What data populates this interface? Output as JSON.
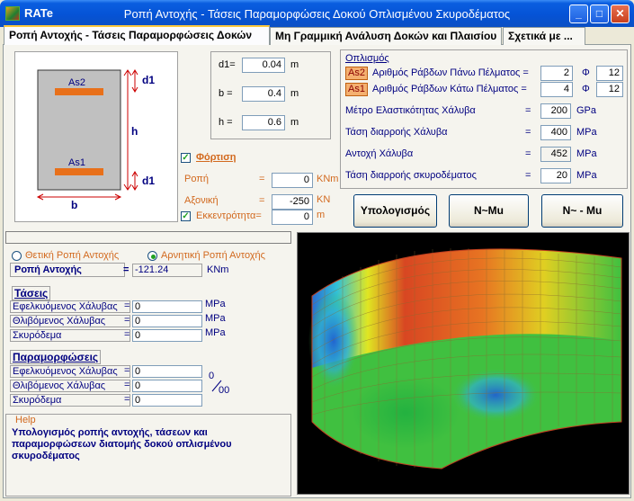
{
  "window": {
    "app_name": "RATe",
    "title": "Ροπή Αντοχής - Τάσεις Παραμορφώσεις Δοκού Οπλισμένου Σκυροδέματος",
    "min_label": "_",
    "max_label": "□",
    "close_label": "✕"
  },
  "tabs": [
    {
      "label": "Ροπή Αντοχής - Τάσεις Παραμορφώσεις Δοκών"
    },
    {
      "label": "Μη Γραμμική Ανάλυση Δοκών και Πλαισίου"
    },
    {
      "label": "Σχετικά με ..."
    }
  ],
  "section": {
    "as2": "As2",
    "as1": "As1",
    "d1_top": "d1",
    "d1_bottom": "d1",
    "h": "h",
    "b": "b"
  },
  "dimensions": {
    "d1_label": "d1=",
    "d1_value": "0.04",
    "b_label": "b =",
    "b_value": "0.4",
    "h_label": "h =",
    "h_value": "0.6",
    "unit": "m"
  },
  "loading": {
    "title": "Φόρτιση",
    "moment_label": "Ροπή",
    "moment_value": "0",
    "moment_unit": "KNm",
    "axial_label": "Αξονική",
    "axial_value": "-250",
    "axial_unit": "KN",
    "eccentricity_label": "Εκκεντρότητα=",
    "eccentricity_value": "0",
    "eccentricity_unit": "m",
    "eq": "="
  },
  "reinforcement": {
    "title": "Οπλισμός",
    "as2_tag": "As2",
    "as2_label": "Αριθμός Ράβδων Πάνω Πέλματος =",
    "as2_count": "2",
    "as2_phi": "Φ",
    "as2_diameter": "12",
    "as1_tag": "As1",
    "as1_label": "Αριθμός Ράβδων Κάτω Πέλματος =",
    "as1_count": "4",
    "as1_phi": "Φ",
    "as1_diameter": "12",
    "steel_modulus_label": "Μέτρο Ελαστικότητας Χάλυβα",
    "steel_modulus_value": "200",
    "steel_modulus_unit": "GPa",
    "steel_yield_label": "Τάση διαρροής Χάλυβα",
    "steel_yield_value": "400",
    "steel_yield_unit": "MPa",
    "steel_strength_label": "Αντοχή Χάλυβα",
    "steel_strength_value": "452",
    "steel_strength_unit": "MPa",
    "concrete_yield_label": "Τάση διαρροής  σκυροδέματος",
    "concrete_yield_value": "20",
    "concrete_yield_unit": "MPa",
    "eq": "="
  },
  "buttons": {
    "compute": "Υπολογισμός",
    "n_mu": "N~Mu",
    "n_mu_alt": "N~ - Mu"
  },
  "results": {
    "positive_moment": "Θετική Ροπή Αντοχής",
    "negative_moment": "Αρνητική Ροπή Αντοχής",
    "moment_label": "Ροπή Αντοχής",
    "moment_eq": "=",
    "moment_value": "-121.24",
    "moment_unit": "KNm",
    "stress_title": "Τάσεις",
    "strain_title": "Παραμορφώσεις",
    "tension_steel": "Εφελκυόμενος Χάλυβας",
    "compression_steel": "Θλιβόμενος Χάλυβας",
    "concrete": "Σκυρόδεμα",
    "eq": "=",
    "stress_tension": "0",
    "stress_compression": "0",
    "stress_concrete": "0",
    "stress_unit": "MPa",
    "strain_tension": "0",
    "strain_compression": "0",
    "strain_concrete": "0",
    "permille_top": "0",
    "permille_bottom": "00"
  },
  "help": {
    "title": "Help",
    "text": "Υπολογισμός ροπής αντοχής, τάσεων και παραμορφώσεων διατομής δοκού οπλισμένου σκυροδέματος"
  },
  "colors": {
    "title_bar": "#0553d6",
    "accent_orange": "#d2691e",
    "navy": "#000080",
    "rebar": "#e8701a"
  }
}
